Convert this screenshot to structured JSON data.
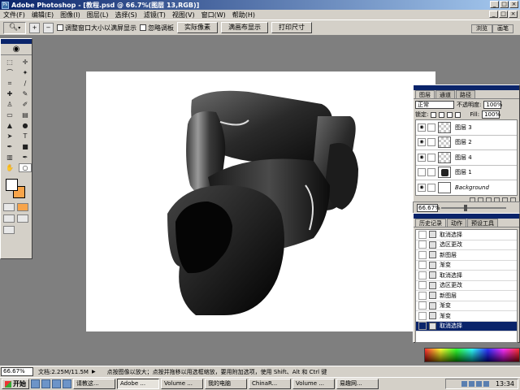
{
  "window": {
    "title": "Adobe Photoshop - [教程.psd @ 66.7%(图层 13,RGB)]",
    "buttons": [
      "_",
      "□",
      "×"
    ]
  },
  "menu": [
    "文件(F)",
    "编辑(E)",
    "图像(I)",
    "图层(L)",
    "选择(S)",
    "滤镜(T)",
    "视图(V)",
    "窗口(W)",
    "帮助(H)"
  ],
  "options": {
    "tool_icon": "zoom-icon",
    "resize_window_label": "调整窗口大小以满屏显示",
    "ignore_palettes_label": "忽略调板",
    "buttons": [
      "实际像素",
      "满画布显示",
      "打印尺寸"
    ],
    "palette_well_tabs": [
      "浏览",
      "画笔"
    ]
  },
  "layers_panel": {
    "tabs": [
      "图层",
      "通道",
      "路径"
    ],
    "blend_mode": "正常",
    "opacity_label": "不透明度:",
    "opacity_value": "100%",
    "lock_label": "锁定:",
    "fill_label": "Fill:",
    "fill_value": "100%",
    "layers": [
      {
        "name": "图层 3",
        "thumb": "transparent"
      },
      {
        "name": "图层 2",
        "thumb": "transparent"
      },
      {
        "name": "图层 4",
        "thumb": "transparent"
      },
      {
        "name": "图层 1",
        "thumb": "dark"
      },
      {
        "name": "Background",
        "thumb": "white"
      }
    ]
  },
  "navigator": {
    "zoom": "66.67%",
    "slider_fraction": 0.35
  },
  "history_panel": {
    "tabs": [
      "历史记录",
      "动作",
      "预设工具"
    ],
    "items": [
      "取消选择",
      "选区更改",
      "新图层",
      "渐变",
      "取消选择",
      "选区更改",
      "新图层",
      "渐变",
      "渐变",
      "取消选择"
    ],
    "selected_index": 9
  },
  "colors": {
    "foreground": "#ffffff",
    "background": "#f7a44a"
  },
  "status": {
    "zoom": "66.67%",
    "doc_info": "文档:2.25M/11.5M",
    "hint": "点按图像以放大；点按并拖移以用选框缩放，要用附加选项，使用 Shift、Alt 和 Ctrl 键"
  },
  "taskbar": {
    "start": "开始",
    "tasks": [
      "请教这...",
      "Adobe ...",
      "Volume ...",
      "我的电脑",
      "ChinaR...",
      "Volume ...",
      "易趣网..."
    ],
    "active_index": 1,
    "clock": "13:34"
  }
}
